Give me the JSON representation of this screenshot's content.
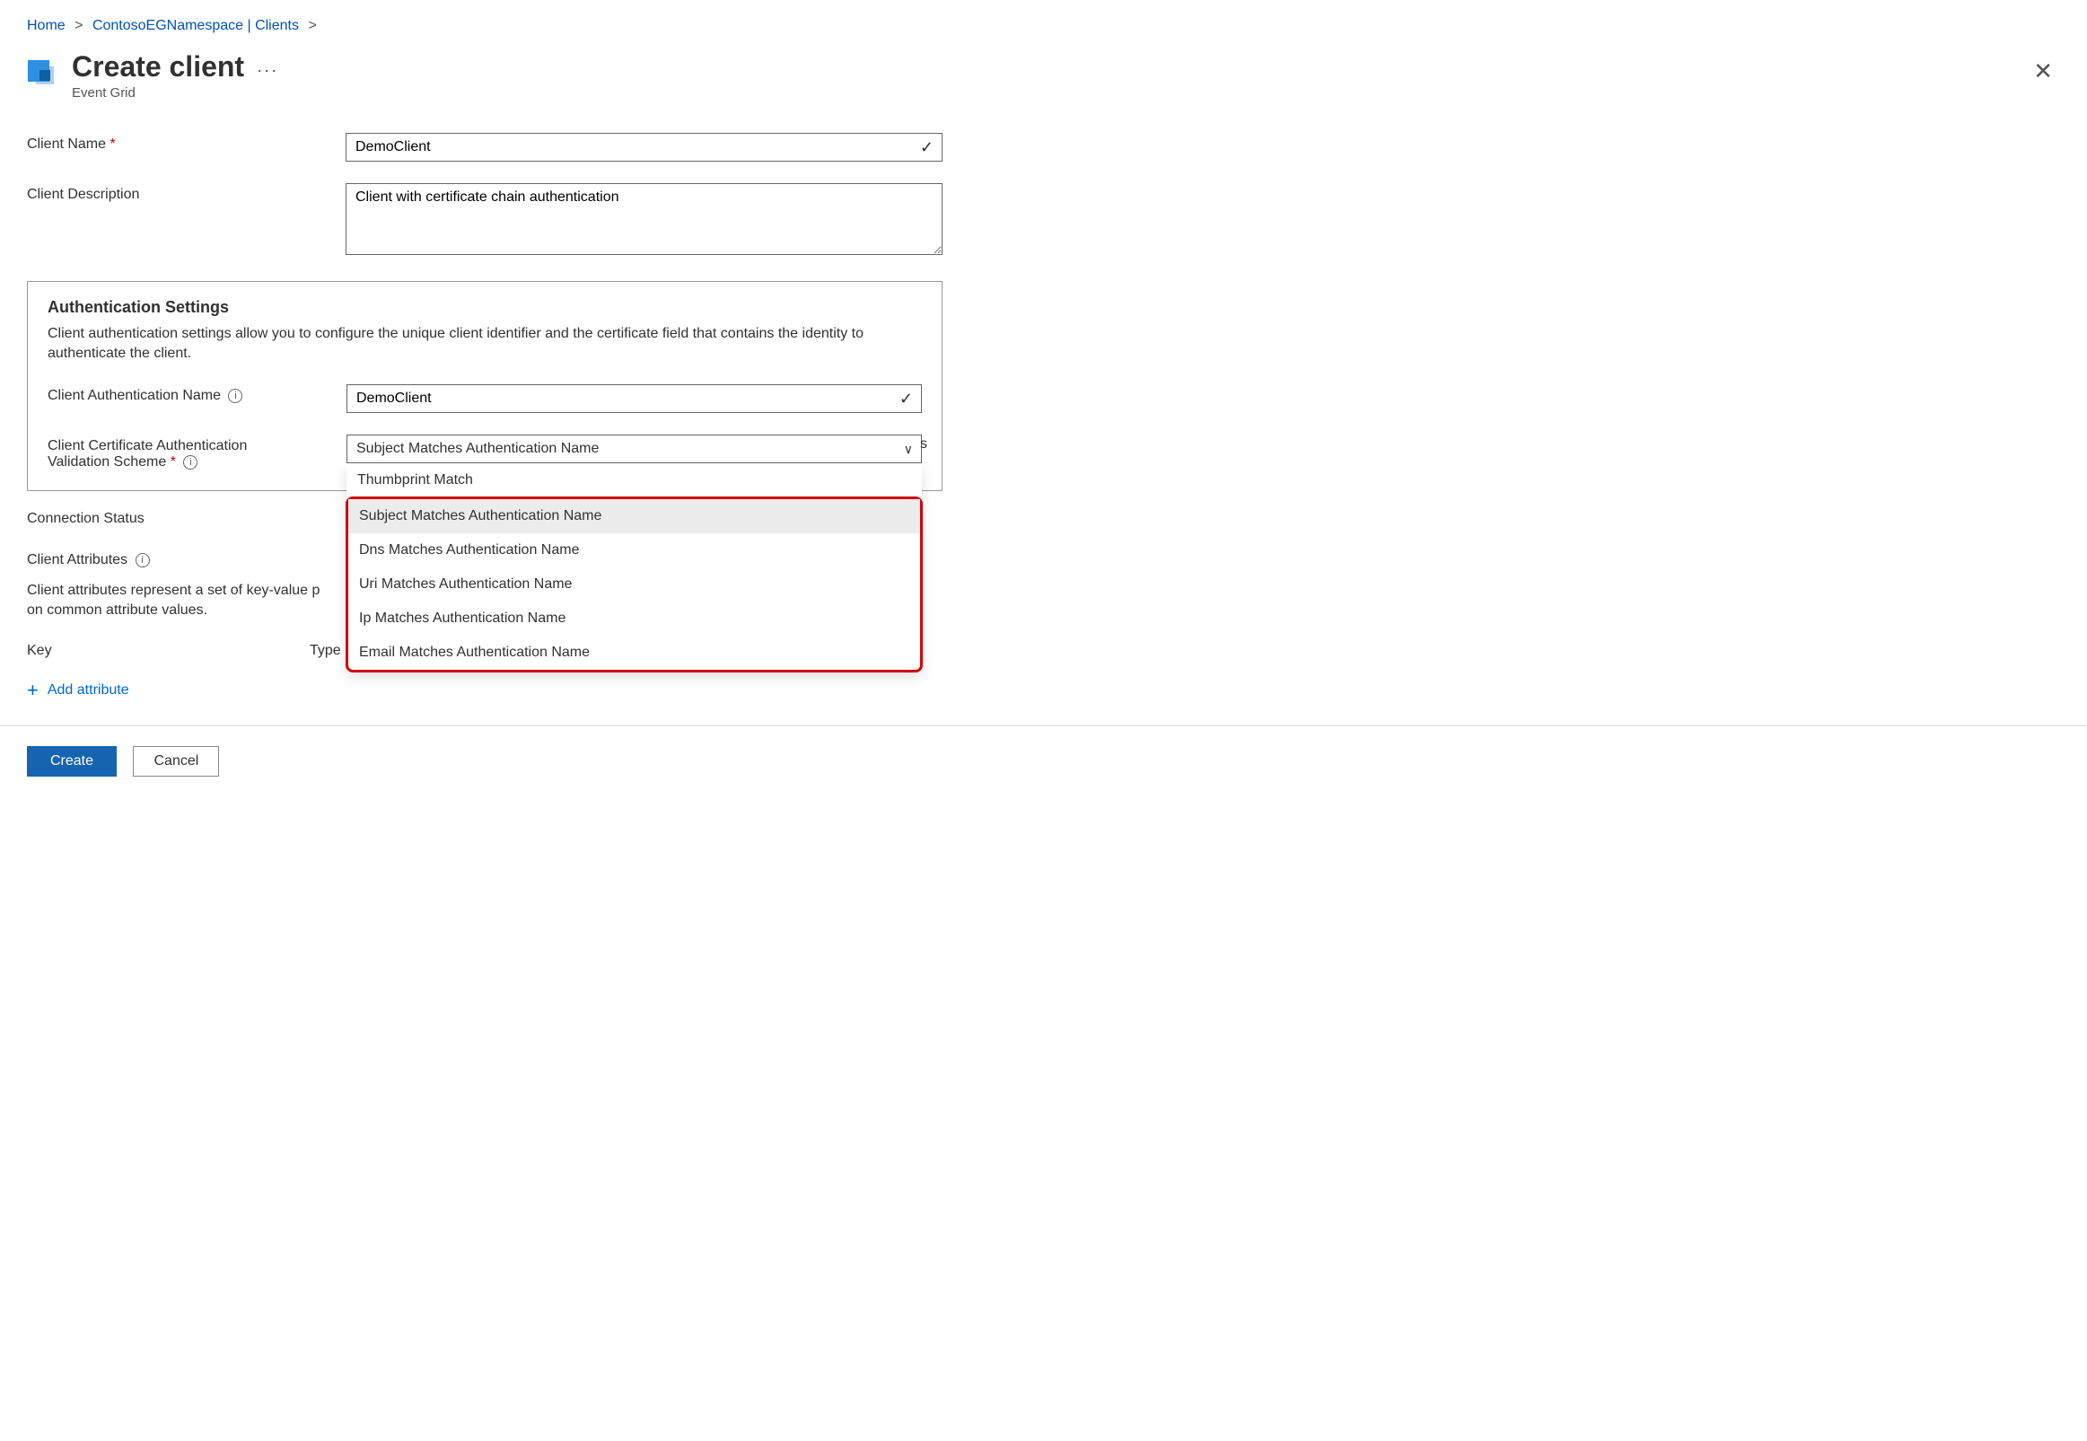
{
  "breadcrumb": {
    "home": "Home",
    "namespace": "ContosoEGNamespace | Clients"
  },
  "header": {
    "title": "Create client",
    "subtitle": "Event Grid",
    "more": "···"
  },
  "form": {
    "client_name_label": "Client Name",
    "client_name_value": "DemoClient",
    "client_desc_label": "Client Description",
    "client_desc_value": "Client with certificate chain authentication"
  },
  "auth": {
    "section_title": "Authentication Settings",
    "section_desc": "Client authentication settings allow you to configure the unique client identifier and the certificate field that contains the identity to authenticate the client.",
    "auth_name_label": "Client Authentication Name",
    "auth_name_value": "DemoClient",
    "scheme_label_line1": "Client Certificate Authentication",
    "scheme_label_line2": "Validation Scheme",
    "scheme_selected": "Subject Matches Authentication Name",
    "scheme_options": [
      "Thumbprint Match",
      "Subject Matches Authentication Name",
      "Dns Matches Authentication Name",
      "Uri Matches Authentication Name",
      "Ip Matches Authentication Name",
      "Email Matches Authentication Name"
    ]
  },
  "connection_status_label": "Connection Status",
  "attributes": {
    "section_label": "Client Attributes",
    "desc_prefix": "Client attributes represent a set of key-value p",
    "desc_suffix": "on common attribute values.",
    "truncated_s": "s",
    "key_header": "Key",
    "type_header": "Type",
    "add_label": "Add attribute"
  },
  "footer": {
    "create": "Create",
    "cancel": "Cancel"
  }
}
